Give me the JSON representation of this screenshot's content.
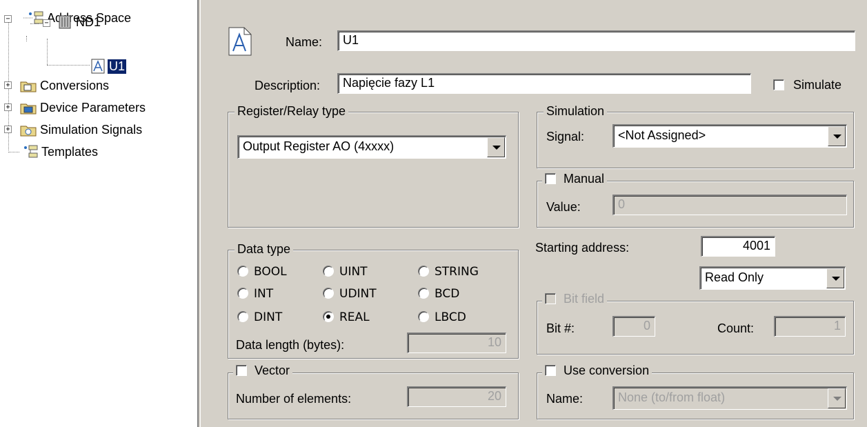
{
  "tree": {
    "root": "Address Space",
    "node": "ND1",
    "leaf": "U1",
    "conversions": "Conversions",
    "device_parameters": "Device Parameters",
    "simulation_signals": "Simulation Signals",
    "templates": "Templates"
  },
  "form": {
    "name_label": "Name:",
    "name_value": "U1",
    "description_label": "Description:",
    "description_value": "Napięcie fazy L1",
    "simulate_label": "Simulate",
    "simulate_checked": false
  },
  "register": {
    "title": "Register/Relay type",
    "selected": "Output Register AO (4xxxx)"
  },
  "simulation": {
    "title": "Simulation",
    "signal_label": "Signal:",
    "signal_value": "<Not Assigned>"
  },
  "manual": {
    "title": "Manual",
    "checked": false,
    "value_label": "Value:",
    "value": "0"
  },
  "datatype": {
    "title": "Data type",
    "options": [
      "BOOL",
      "UINT",
      "STRING",
      "INT",
      "UDINT",
      "BCD",
      "DINT",
      "REAL",
      "LBCD"
    ],
    "selected": "REAL",
    "length_label": "Data length (bytes):",
    "length_value": "10"
  },
  "vector": {
    "title": "Vector",
    "checked": false,
    "count_label": "Number of elements:",
    "count_value": "20"
  },
  "address": {
    "label": "Starting address:",
    "value": "4001",
    "access": "Read Only"
  },
  "bitfield": {
    "title": "Bit field",
    "checked": false,
    "bit_label": "Bit #:",
    "bit_value": "0",
    "count_label": "Count:",
    "count_value": "1"
  },
  "conversion": {
    "title": "Use conversion",
    "checked": false,
    "name_label": "Name:",
    "name_value": "None (to/from float)"
  },
  "colors": {
    "face": "#d4d0c8",
    "selection": "#0a246a"
  }
}
